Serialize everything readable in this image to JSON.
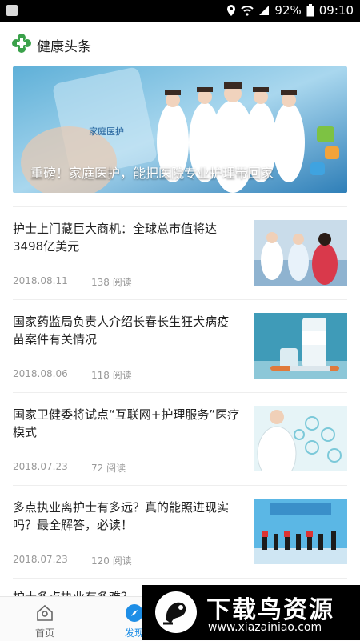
{
  "status_bar": {
    "battery": "92%",
    "time": "09:10",
    "icons": [
      "location-icon",
      "wifi-icon",
      "signal-icon",
      "battery-icon"
    ]
  },
  "header": {
    "title": "健康头条",
    "logo_icon": "cross-clover-logo",
    "accent": "#3aa14a"
  },
  "banner": {
    "caption": "重磅！家庭医护，能把医院专业护理带回家",
    "image_text": "家庭医护"
  },
  "articles": [
    {
      "title": "护士上门藏巨大商机：全球总市值将达3498亿美元",
      "date": "2018.08.11",
      "reads": "138 阅读"
    },
    {
      "title": "国家药监局负责人介绍长春长生狂犬病疫苗案件有关情况",
      "date": "2018.08.06",
      "reads": "118 阅读"
    },
    {
      "title": "国家卫健委将试点“互联网+护理服务”医疗模式",
      "date": "2018.07.23",
      "reads": "72 阅读"
    },
    {
      "title": "多点执业离护士有多远？真的能照进现实吗？最全解答，必读！",
      "date": "2018.07.23",
      "reads": "120 阅读"
    }
  ],
  "partial_article": "护士多点执业有多难？",
  "tabs": [
    {
      "label": "首页",
      "icon": "home-icon",
      "active": false
    },
    {
      "label": "发现",
      "icon": "compass-icon",
      "active": true
    }
  ],
  "watermark": {
    "title": "下载鸟资源",
    "url": "www.xiazainiao.com"
  },
  "colors": {
    "active_tab": "#1e8ee6",
    "inactive_tab": "#666666"
  }
}
